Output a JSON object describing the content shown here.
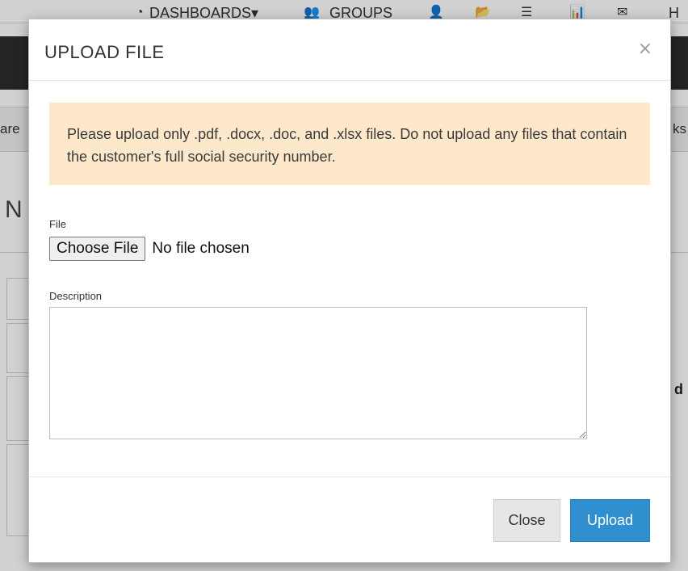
{
  "background": {
    "nav": {
      "dashboards_label": "DASHBOARDS▾",
      "groups_label": "GROUPS",
      "last_label": "H"
    },
    "crumb_left": "are",
    "crumb_right": "ks",
    "heading_fragment": "N",
    "right_col_fragment": "d"
  },
  "modal": {
    "title": "UPLOAD FILE",
    "close_glyph": "×",
    "alert_text": "Please upload only .pdf, .docx, .doc, and .xlsx files. Do not upload any files that contain the customer's full social security number.",
    "file_label": "File",
    "choose_file_label": "Choose File",
    "no_file_text": "No file chosen",
    "description_label": "Description",
    "description_value": "",
    "close_button": "Close",
    "upload_button": "Upload"
  },
  "colors": {
    "alert_bg": "#fde8cb",
    "primary": "#2f8fcf",
    "secondary": "#e6e6e6",
    "dark_bar": "#2d2d2d"
  }
}
